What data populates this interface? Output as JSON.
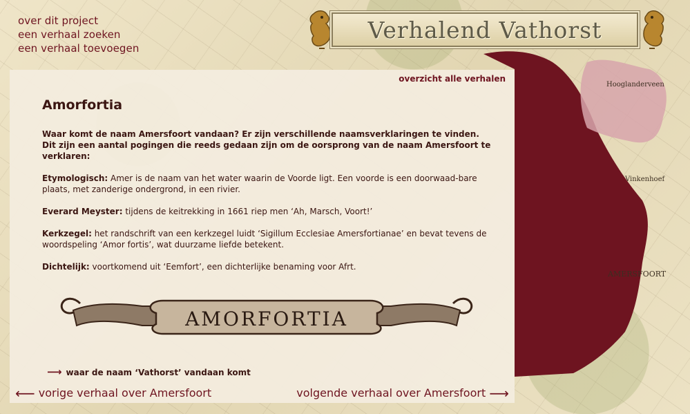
{
  "site": {
    "title": "Verhalend Vathorst",
    "logo_lions": "lion-crest-icon"
  },
  "nav": {
    "items": [
      {
        "label": "over dit project"
      },
      {
        "label": "een verhaal zoeken"
      },
      {
        "label": "een verhaal toevoegen"
      }
    ]
  },
  "map": {
    "place_labels": [
      "Hooglanderveen",
      "Vinkenhoef",
      "AMERSFOORT"
    ],
    "highlight_color": "#6e1420",
    "secondary_color": "#d7a5ab"
  },
  "story": {
    "overview_link": "overzicht alle verhalen",
    "title": "Amorfortia",
    "intro": "Waar komt de naam Amersfoort vandaan? Er zijn verschillende naamsverklaringen te vinden. Dit zijn een aantal pogingen die reeds gedaan zijn om de oorsprong van de naam Amersfoort te verklaren:",
    "sections": [
      {
        "term": "Etymologisch:",
        "text": " Amer is de naam van het water waarin de Voorde ligt. Een voorde is een doorwaad-bare plaats, met zanderige ondergrond, in een rivier."
      },
      {
        "term": "Everard Meyster:",
        "text": " tijdens de keitrekking in 1661 riep men ‘Ah, Marsch, Voort!’"
      },
      {
        "term": "Kerkzegel:",
        "text": " het randschrift van een kerkzegel luidt ‘Sigillum Ecclesiae Amersfortianae’ en bevat tevens de woordspeling ‘Amor fortis’, wat duurzame liefde betekent."
      },
      {
        "term": "Dichtelijk:",
        "text": " voortkomend uit ‘Eemfort’, een dichterlijke benaming voor Afrt."
      }
    ],
    "banner_text": "AMORFORTIA",
    "related_link": "waar de naam ‘Vathorst’ vandaan komt"
  },
  "pager": {
    "prev": "vorige verhaal over Amersfoort",
    "next": "volgende verhaal over Amersfoort"
  }
}
